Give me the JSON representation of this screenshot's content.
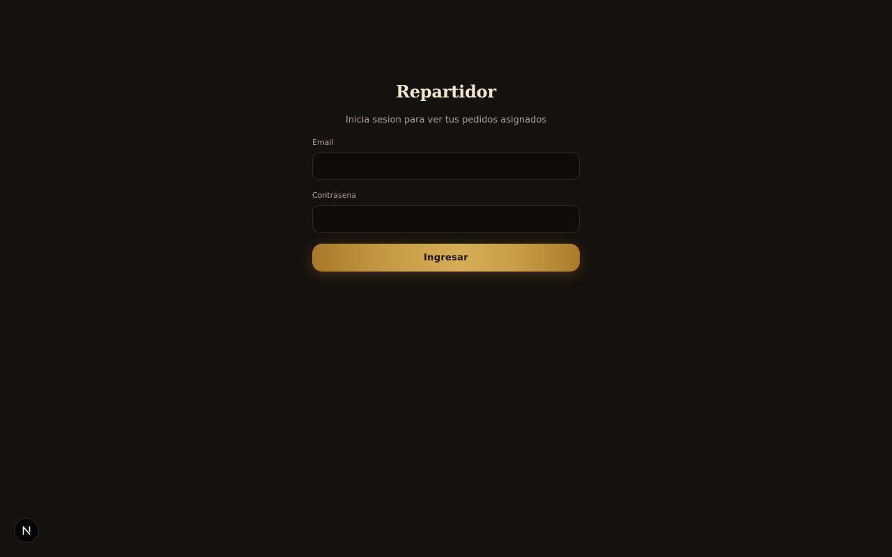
{
  "login": {
    "title": "Repartidor",
    "subtitle": "Inicia sesion para ver tus pedidos asignados",
    "email": {
      "label": "Email",
      "value": "",
      "placeholder": ""
    },
    "password": {
      "label": "Contrasena",
      "value": "",
      "placeholder": ""
    },
    "submit_label": "Ingresar"
  },
  "dev_badge": {
    "icon": "nextjs-icon"
  },
  "colors": {
    "background": "#15110e",
    "accent": "#c99d47",
    "text_primary": "#f2e6cf",
    "text_secondary": "#a9a092"
  }
}
